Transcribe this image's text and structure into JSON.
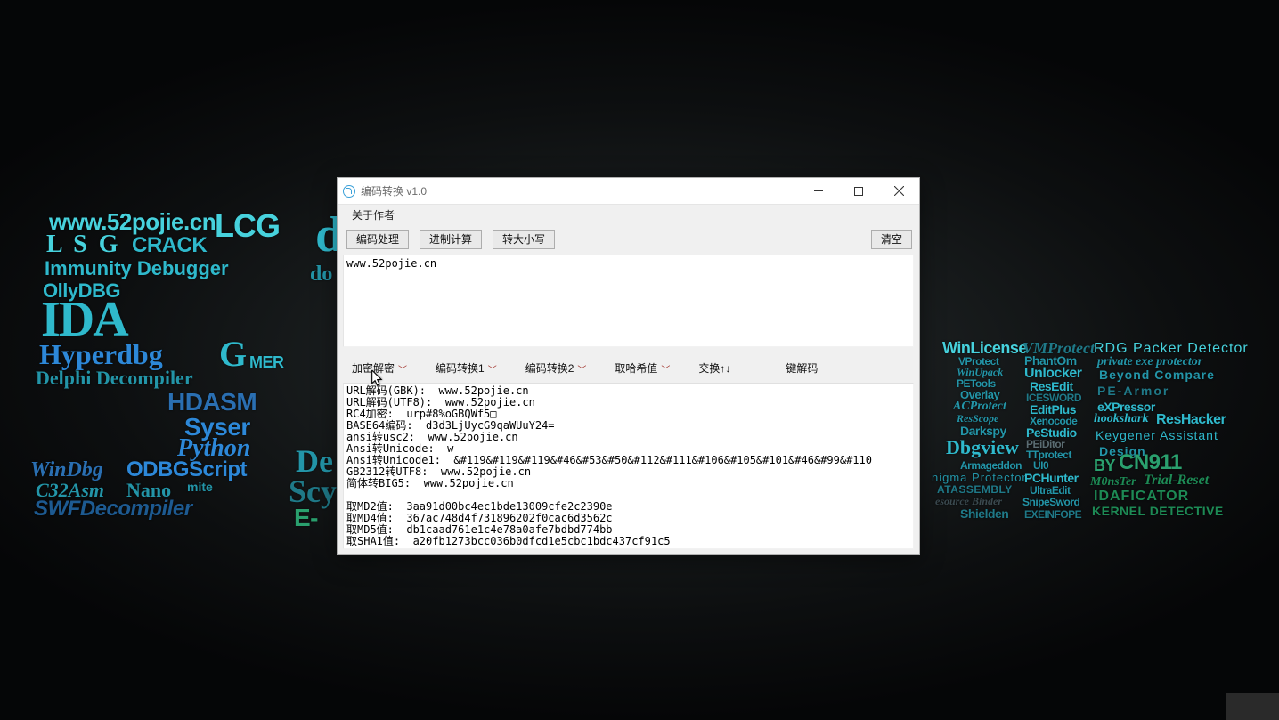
{
  "window": {
    "title": "编码转换 v1.0",
    "menu": {
      "about": "关于作者"
    },
    "toolbar": {
      "encode": "编码处理",
      "base": "进制计算",
      "case": "转大小写",
      "clear": "清空"
    },
    "input_text": "www.52pojie.cn",
    "midbar": {
      "encrypt": "加密解密",
      "conv1": "编码转换1",
      "conv2": "编码转换2",
      "hash": "取哈希值",
      "swap": "交换↑↓",
      "decode": "一键解码"
    },
    "output_lines": [
      "URL解码(GBK):  www.52pojie.cn",
      "URL解码(UTF8):  www.52pojie.cn",
      "RC4加密:  urp#8%oGBQWf5□",
      "BASE64编码:  d3d3LjUycG9qaWUuY24=",
      "ansi转usc2:  www.52pojie.cn",
      "Ansi转Unicode:  w",
      "Ansi转Unicode1:  &#119&#119&#119&#46&#53&#50&#112&#111&#106&#105&#101&#46&#99&#110",
      "GB2312转UTF8:  www.52pojie.cn",
      "简体转BIG5:  www.52pojie.cn",
      "",
      "取MD2值:  3aa91d00bc4ec1bde13009cfe2c2390e",
      "取MD4值:  367ac748d4f731896202f0cac6d3562c",
      "取MD5值:  db1caad761e1c4e78a0afe7bdbd774bb",
      "取SHA1值:  a20fb1273bcc036b0dfcd1e5cbc1bdc437cf91c5"
    ]
  },
  "bg_left": {
    "l1": "www.52pojie.cn",
    "l2a": "L S G",
    "l2b": "CRACK",
    "l2c": "LCG",
    "l3": "Immunity Debugger",
    "l4": "OllyDBG",
    "l5": "IDA",
    "l6a": "Hyperdbg",
    "l6b": "G",
    "l6c": "MER",
    "l7": "Delphi Decompiler",
    "l8": "HDASM",
    "l9": "Syser",
    "l10": "Python",
    "l11a": "WinDbg",
    "l11b": "ODBGScript",
    "l12a": "C32Asm",
    "l12b": "Nano",
    "l12c": "mite",
    "l13": "SWFDecompiler",
    "c1": "d",
    "c2": "do",
    "c3": "De",
    "c4": "Scy",
    "c5": "E-"
  },
  "bg_right": {
    "r1a": "WinLicense",
    "r1b": "VMProtect",
    "r1c": "RDG Packer Detector",
    "r2a": "VProtect",
    "r2b": "PhantOm",
    "r2c": "private exe protector",
    "r3a": "WinUpack",
    "r3b": "Unlocker",
    "r3c": "Beyond Compare",
    "r4a": "PETools",
    "r4b": "ResEdit",
    "r5a": "Overlay",
    "r5b": "ICESWORD",
    "r5c": "PE-Armor",
    "r6a": "ACProtect",
    "r6b": "EditPlus",
    "r6c": "eXPressor",
    "r7a": "ResScope",
    "r7b": "Xenocode",
    "r8a": "Darkspy",
    "r8b": "PeStudio",
    "r8c": "hookshark",
    "r8d": "ResHacker",
    "r9a": "Dbgview",
    "r9b": "TTprotect",
    "r9c": "Keygener Assistant",
    "r10a": "Armageddon",
    "r10b": "UI0",
    "r10c": "Design",
    "r11a": "nigma Protector",
    "r11b": "PCHunter",
    "r11c": "BY",
    "r11d": "CN911",
    "r12a": "ATASSEMBLY",
    "r12b": "UltraEdit",
    "r12c": "M0nsTer",
    "r12d": "Trial-Reset",
    "r13a": "esource Binder",
    "r13b": "SnipeSword",
    "r13c": "IDAFICATOR",
    "r14a": "Shielden",
    "r14b": "EXEINFOPE",
    "r14c": "KERNEL DETECTIVE",
    "r15a": "PEiDitor"
  }
}
